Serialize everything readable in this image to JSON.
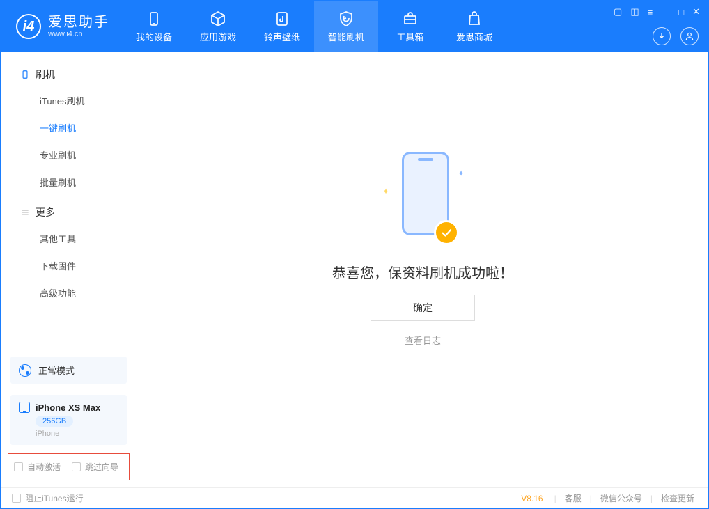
{
  "app": {
    "name": "爱思助手",
    "url": "www.i4.cn"
  },
  "tabs": [
    {
      "label": "我的设备"
    },
    {
      "label": "应用游戏"
    },
    {
      "label": "铃声壁纸"
    },
    {
      "label": "智能刷机"
    },
    {
      "label": "工具箱"
    },
    {
      "label": "爱思商城"
    }
  ],
  "sidebar": {
    "section1": {
      "title": "刷机",
      "items": [
        "iTunes刷机",
        "一键刷机",
        "专业刷机",
        "批量刷机"
      ]
    },
    "section2": {
      "title": "更多",
      "items": [
        "其他工具",
        "下载固件",
        "高级功能"
      ]
    }
  },
  "mode": {
    "label": "正常模式"
  },
  "device": {
    "name": "iPhone XS Max",
    "storage": "256GB",
    "type": "iPhone"
  },
  "options": {
    "auto_activate": "自动激活",
    "skip_guide": "跳过向导"
  },
  "main": {
    "success": "恭喜您，保资料刷机成功啦！",
    "ok": "确定",
    "view_log": "查看日志"
  },
  "footer": {
    "block_itunes": "阻止iTunes运行",
    "version": "V8.16",
    "support": "客服",
    "wechat": "微信公众号",
    "update": "检查更新"
  }
}
